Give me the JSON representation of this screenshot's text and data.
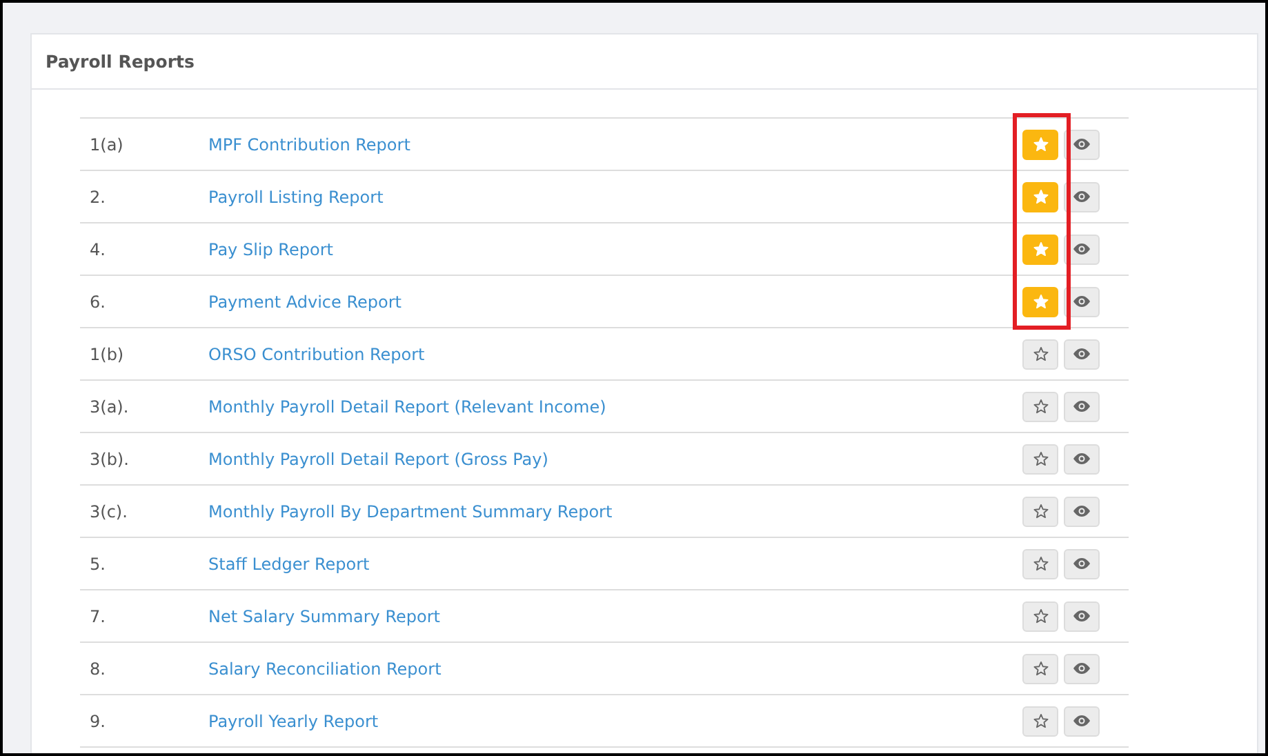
{
  "panel": {
    "title": "Payroll Reports"
  },
  "reports": [
    {
      "number": "1(a)",
      "name": "MPF Contribution Report",
      "favorite": true
    },
    {
      "number": "2.",
      "name": "Payroll Listing Report",
      "favorite": true
    },
    {
      "number": "4.",
      "name": "Pay Slip Report",
      "favorite": true
    },
    {
      "number": "6.",
      "name": "Payment Advice Report",
      "favorite": true
    },
    {
      "number": "1(b)",
      "name": "ORSO Contribution Report",
      "favorite": false
    },
    {
      "number": "3(a).",
      "name": "Monthly Payroll Detail Report (Relevant Income)",
      "favorite": false
    },
    {
      "number": "3(b).",
      "name": "Monthly Payroll Detail Report (Gross Pay)",
      "favorite": false
    },
    {
      "number": "3(c).",
      "name": "Monthly Payroll By Department Summary Report",
      "favorite": false
    },
    {
      "number": "5.",
      "name": "Staff Ledger Report",
      "favorite": false
    },
    {
      "number": "7.",
      "name": "Net Salary Summary Report",
      "favorite": false
    },
    {
      "number": "8.",
      "name": "Salary Reconciliation Report",
      "favorite": false
    },
    {
      "number": "9.",
      "name": "Payroll Yearly Report",
      "favorite": false
    }
  ]
}
